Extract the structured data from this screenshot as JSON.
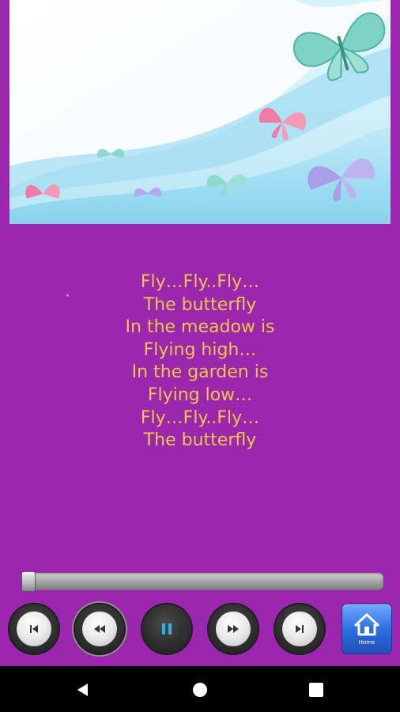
{
  "lyrics": {
    "lines": [
      "Fly…Fly..Fly…",
      "The butterfly",
      "In the meadow is",
      "Flying high…",
      "In the garden is",
      "Flying low…",
      "Fly…Fly..Fly…",
      "The butterfly"
    ]
  },
  "player": {
    "progress": 0.0,
    "home_label": "Home",
    "controls": {
      "previous_icon": "skip-previous-icon",
      "rewind_icon": "rewind-icon",
      "pause_icon": "pause-icon",
      "fast_forward_icon": "fast-forward-icon",
      "next_icon": "skip-next-icon",
      "home_icon": "home-icon"
    }
  },
  "colors": {
    "background": "#9a27ad",
    "lyrics_text": "#f5c34e",
    "pause_icon": "#27b6e6",
    "home_button": "#2f6fe3"
  },
  "system_nav": {
    "back_icon": "back-triangle-icon",
    "home_icon": "home-circle-icon",
    "recents_icon": "recents-square-icon"
  }
}
